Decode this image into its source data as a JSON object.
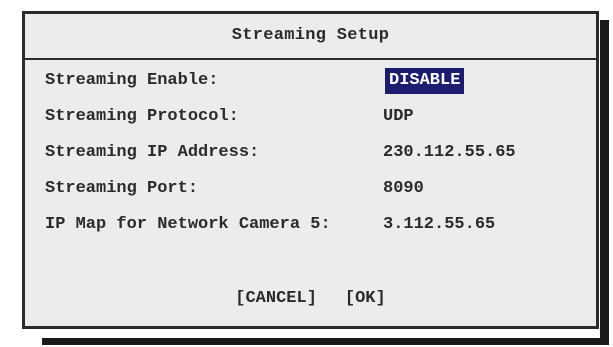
{
  "dialog": {
    "title": "Streaming Setup"
  },
  "fields": [
    {
      "label": "Streaming Enable:",
      "value": "DISABLE"
    },
    {
      "label": "Streaming Protocol:",
      "value": "UDP"
    },
    {
      "label": "Streaming IP Address:",
      "value": "230.112.55.65"
    },
    {
      "label": "Streaming Port:",
      "value": "8090"
    },
    {
      "label": "IP Map for Network Camera 5:",
      "value": "3.112.55.65"
    }
  ],
  "buttons": {
    "cancel_label": "[CANCEL]",
    "ok_label": "[OK]"
  },
  "colors": {
    "selection_background": "#1c1d6e",
    "dialog_background": "#ececec",
    "text": "#2b2b2b"
  }
}
